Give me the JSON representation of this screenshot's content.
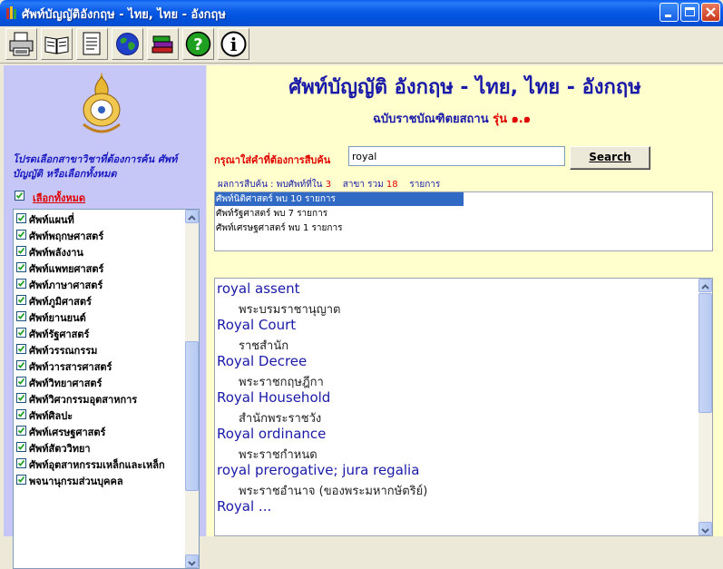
{
  "window": {
    "title": "ศัพท์บัญญัติอังกฤษ - ไทย, ไทย - อังกฤษ",
    "controls": [
      "minimize-icon",
      "maximize-icon",
      "close-icon"
    ]
  },
  "toolbar": {
    "buttons": [
      "printer-icon",
      "book-icon",
      "document-icon",
      "globe-icon",
      "books-icon",
      "help-icon",
      "info-icon"
    ]
  },
  "left_panel": {
    "prompt": "โปรดเลือกสาขาวิชาที่ต้องการค้น ศัพท์บัญญัติ หรือเลือกทั้งหมด",
    "select_all_label": "เลือกทั้งหมด",
    "select_all_checked": true,
    "categories": [
      {
        "label": "ศัพท์แผนที่",
        "checked": true
      },
      {
        "label": "ศัพท์พฤกษศาสตร์",
        "checked": true
      },
      {
        "label": "ศัพท์พลังงาน",
        "checked": true
      },
      {
        "label": "ศัพท์แพทยศาสตร์",
        "checked": true
      },
      {
        "label": "ศัพท์ภาษาศาสตร์",
        "checked": true
      },
      {
        "label": "ศัพท์ภูมิศาสตร์",
        "checked": true
      },
      {
        "label": "ศัพท์ยานยนต์",
        "checked": true
      },
      {
        "label": "ศัพท์รัฐศาสตร์",
        "checked": true
      },
      {
        "label": "ศัพท์วรรณกรรม",
        "checked": true
      },
      {
        "label": "ศัพท์วารสารศาสตร์",
        "checked": true
      },
      {
        "label": "ศัพท์วิทยาศาสตร์",
        "checked": true
      },
      {
        "label": "ศัพท์วิศวกรรมอุตสาหการ",
        "checked": true
      },
      {
        "label": "ศัพท์ศิลปะ",
        "checked": true
      },
      {
        "label": "ศัพท์เศรษฐศาสตร์",
        "checked": true
      },
      {
        "label": "ศัพท์สัตววิทยา",
        "checked": true
      },
      {
        "label": "ศัพท์อุตสาหกรรมเหล็กและเหล็ก",
        "checked": true
      },
      {
        "label": "พจนานุกรมส่วนบุคคล",
        "checked": true
      }
    ]
  },
  "header": {
    "title": "ศัพท์บัญญัติ อังกฤษ - ไทย, ไทย - อังกฤษ",
    "edition": "ฉบับราชบัณฑิตยสถาน",
    "version": "รุ่น ๑.๑"
  },
  "search": {
    "label": "กรุณาใส่คำที่ต้องการสืบค้น",
    "value": "royal",
    "button_label": "Search"
  },
  "summary": {
    "prefix": "ผลการสืบค้น : พบศัพท์ที่ใน",
    "branch_count": "3",
    "branch_label": "สาขา  รวม",
    "total": "18",
    "suffix": "รายการ"
  },
  "results": [
    {
      "label": "ศัพท์นิติศาสตร์ พบ 10 รายการ",
      "selected": true
    },
    {
      "label": "ศัพท์รัฐศาสตร์ พบ 7 รายการ",
      "selected": false
    },
    {
      "label": "ศัพท์เศรษฐศาสตร์ พบ 1 รายการ",
      "selected": false
    }
  ],
  "definitions": [
    {
      "term": "royal assent",
      "thai": "พระบรมราชานุญาต"
    },
    {
      "term": "Royal Court",
      "thai": "ราชสำนัก"
    },
    {
      "term": "Royal Decree",
      "thai": "พระราชกฤษฎีกา"
    },
    {
      "term": "Royal Household",
      "thai": "สำนักพระราชวัง"
    },
    {
      "term": "Royal ordinance",
      "thai": "พระราชกำหนด"
    },
    {
      "term": "royal prerogative; jura regalia",
      "thai": "พระราชอำนาจ (ของพระมหากษัตริย์)"
    },
    {
      "term": "Royal ...",
      "thai": ""
    }
  ],
  "colors": {
    "left_bg": "#C7C7F7",
    "right_bg": "#FFFFCE",
    "heading_blue": "#1A1AA8",
    "accent_red": "#E00000",
    "selection": "#316AC5"
  }
}
